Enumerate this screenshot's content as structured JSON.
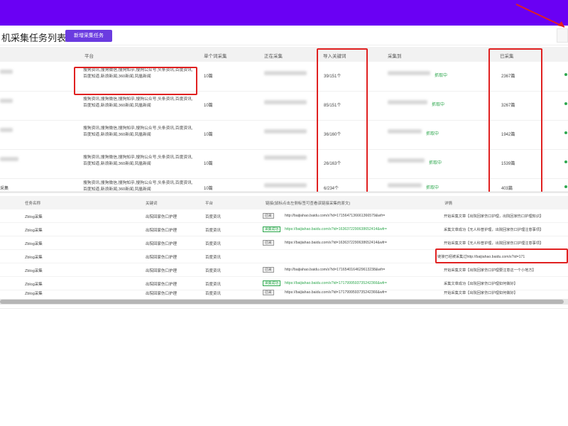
{
  "header": {
    "page_title": "机采集任务列表",
    "new_button": "新增采集任务"
  },
  "task_table": {
    "columns": [
      "平台",
      "单个词采集",
      "正在采集",
      "导入关键词",
      "采集到",
      "已采集"
    ],
    "rows": [
      {
        "platform": "搜狗资讯,搜狗微信,搜狗知乎,搜狗公众号,头条资讯,百度资讯,百度知道,新浪新闻,360新闻,凤凰新闻",
        "per_word": "10篇",
        "keywords": "39/151个",
        "status": "抓取中",
        "collected": "2367篇"
      },
      {
        "platform": "搜狗资讯,搜狗微信,搜狗知乎,搜狗公众号,头条资讯,百度资讯,百度知道,新浪新闻,360新闻,凤凰新闻",
        "per_word": "10篇",
        "keywords": "85/151个",
        "status": "抓取中",
        "collected": "3267篇"
      },
      {
        "platform": "搜狗资讯,搜狗微信,搜狗知乎,搜狗公众号,头条资讯,百度资讯,百度知道,新浪新闻,360新闻,凤凰新闻",
        "per_word": "10篇",
        "keywords": "36/160个",
        "status": "抓取中",
        "collected": "1942篇"
      },
      {
        "platform": "搜狗资讯,搜狗微信,搜狗知乎,搜狗公众号,头条资讯,百度资讯,百度知道,新浪新闻,360新闻,凤凰新闻",
        "per_word": "10篇",
        "keywords": "26/163个",
        "status": "抓取中",
        "collected": "1539篇"
      },
      {
        "platform": "搜狗资讯,搜狗微信,搜狗知乎,搜狗公众号,头条资讯,百度资讯,百度知道,新浪新闻,360新闻,凤凰新闻",
        "per_word": "10篇",
        "keywords": "6/234个",
        "status": "抓取中",
        "collected": "403篇"
      }
    ],
    "last_row_left": "采集"
  },
  "log_table": {
    "columns": [
      "任务名称",
      "关键词",
      "平台",
      "链接(鼠标点击左侧标签可查看该链接采集的原文)",
      "详情"
    ],
    "rows": [
      {
        "task": "Zblog采集",
        "keyword": "出院回家伤口护理",
        "platform": "百度资讯",
        "tag": "已采",
        "tag_ok": false,
        "url": "http://baijiahao.baidu.com/s?id=1715647136661366579&wfr=",
        "url_green": false,
        "detail": "开始采集文章【出院回家伤口护理，出院回家伤口护理知识】"
      },
      {
        "task": "Zblog采集",
        "keyword": "出院回家伤口护理",
        "platform": "百度资讯",
        "tag": "采集成功",
        "tag_ok": true,
        "url": "https://baijiahao.baidu.com/s?id=1636372290638652414&wfr=",
        "url_green": true,
        "detail": "采集文章成功【无人科普护理，出院回家伤口护理注意事项】"
      },
      {
        "task": "Zblog采集",
        "keyword": "出院回家伤口护理",
        "platform": "百度资讯",
        "tag": "已采",
        "tag_ok": false,
        "url": "https://baijiahao.baidu.com/s?id=1636372290638652414&wfr=",
        "url_green": false,
        "detail": "开始采集文章【无人科普护理，出院回家伤口护理注意事项】"
      },
      {
        "task": "Zblog采集",
        "keyword": "出院回家伤口护理",
        "platform": "百度资讯",
        "tag": "",
        "tag_ok": false,
        "url": "",
        "url_green": false,
        "detail": "链接已经被采集过http://baijiahao.baidu.com/s?id=171"
      },
      {
        "task": "Zblog采集",
        "keyword": "出院回家伤口护理",
        "platform": "百度资讯",
        "tag": "已采",
        "tag_ok": false,
        "url": "http://baijiahao.baidu.com/s?id=1716540164629613238&wfr=",
        "url_green": false,
        "detail": "开始采集文章【出院回家伤口护理要注意这一个小地方】"
      },
      {
        "task": "Zblog采集",
        "keyword": "出院回家伤口护理",
        "platform": "百度资讯",
        "tag": "采集成功",
        "tag_ok": true,
        "url": "https://baijiahao.baidu.com/s?id=1717999593735242366&wfr=",
        "url_green": true,
        "detail": "采集文章成功【出院回家伤口护理如何做好】"
      },
      {
        "task": "Zblog采集",
        "keyword": "出院回家伤口护理",
        "platform": "百度资讯",
        "tag": "已采",
        "tag_ok": false,
        "url": "https://baijiahao.baidu.com/s?id=1717999593735242366&wfr=",
        "url_green": false,
        "detail": "开始采集文章【出院回家伤口护理如何做好】"
      }
    ]
  },
  "colors": {
    "brand": "#6a00f4",
    "button": "#6a3be0",
    "highlight": "#e02020",
    "success": "#2fa84f"
  }
}
